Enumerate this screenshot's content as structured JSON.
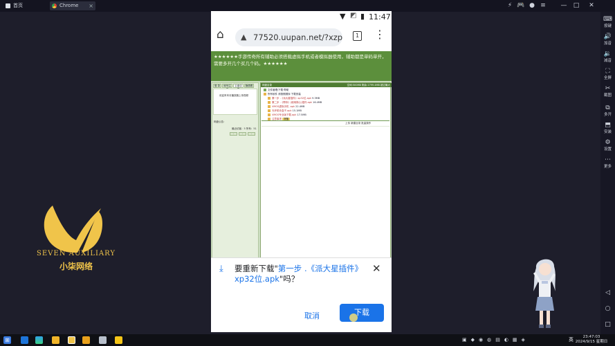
{
  "tabs": [
    {
      "label": "首页"
    },
    {
      "label": "Chrome"
    }
  ],
  "sidebar": [
    {
      "label": "按键",
      "glyph": "⌨"
    },
    {
      "label": "加音",
      "glyph": "🔊"
    },
    {
      "label": "减音",
      "glyph": "🔉"
    },
    {
      "label": "全屏",
      "glyph": "⛶"
    },
    {
      "label": "截图",
      "glyph": "✂"
    },
    {
      "label": "多开",
      "glyph": "⧉"
    },
    {
      "label": "安装",
      "glyph": "⬒"
    },
    {
      "label": "设置",
      "glyph": "⚙"
    },
    {
      "label": "更多",
      "glyph": "⋯"
    }
  ],
  "nav": [
    "◁",
    "○",
    "□"
  ],
  "brand": {
    "en": "SEVEN AUXILIARY",
    "cn": "小柒网络"
  },
  "phone": {
    "time": "11:47",
    "url": "77520.uupan.net/?xzpd=",
    "tab_count": "1",
    "notice": "★★★★★★手游传奇所有辅助必须搭载虚拟手机或者模拟器使用，辅助都是单码单开，需要多开几个买几个码。★★★★★★",
    "left_tabs": [
      "登 录",
      "帐号注册",
      "云盘目录",
      "随便看"
    ],
    "left_text": "欢迎来本月播放器上传视频",
    "left_footer": "网盘公告：",
    "left_links": "最近访客：5  所有：51",
    "btns": [
      "·",
      "·",
      "·"
    ],
    "bar1_left": "网盘目录",
    "bar1_right": "空间:500MB 剩余:1799.4MB 超过最大",
    "bar2": "文件管理/下载·帮助",
    "folder_title": "所有软件 请按照顺序·下载安装",
    "files": [
      {
        "name": "第一步 .《派大星插件》xp32位.apk",
        "size": "9.3MB"
      },
      {
        "name": "第二步 .《帮你》(使用核心)插件.apk",
        "size": "16.4MB"
      },
      {
        "name": "VMOS虚拟手机 .apk",
        "size": "22.4MB"
      },
      {
        "name": "光环助手盒子.apk",
        "size": "15.1MB"
      },
      {
        "name": "VMOS专业版下载.apk",
        "size": "17.5MB"
      },
      {
        "name": "注意事项",
        "size": "提醒"
      }
    ],
    "footer_links": [
      "上传",
      "新建目录",
      "批量操作"
    ],
    "download_prefix": "要重新下载\"",
    "download_file": "第一步 .《派大星插件》xp32位.apk",
    "download_suffix": "\"吗？",
    "cancel": "取消",
    "download": "下载"
  },
  "clock": {
    "time": "23:47:03",
    "date": "2024/9/15 星期日"
  },
  "tray": "英"
}
